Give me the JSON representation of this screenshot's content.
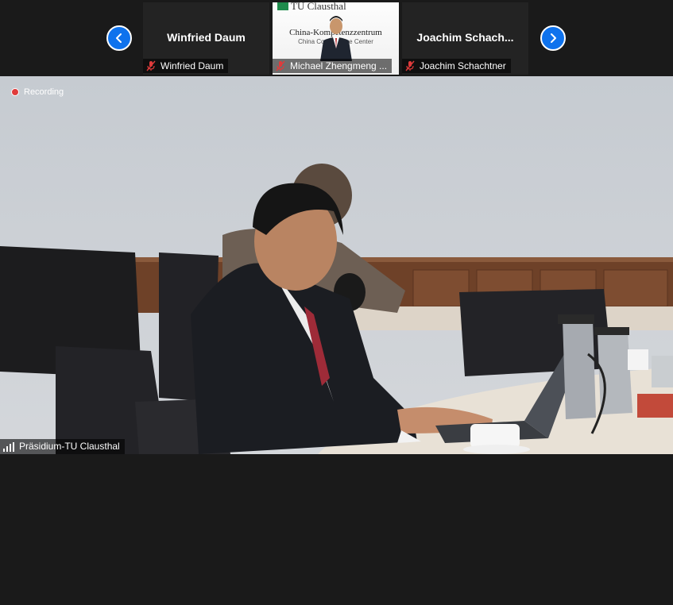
{
  "recording": {
    "label": "Recording"
  },
  "gallery": {
    "participants": [
      {
        "display_name": "Winfried Daum",
        "label": "Winfried Daum",
        "muted": true,
        "video": false
      },
      {
        "display_name": "",
        "label": "Michael Zhengmeng ...",
        "muted": true,
        "video": true,
        "background": {
          "org": "TU Clausthal",
          "line1": "China-Kompetenzzentrum",
          "line2": "China Competence Center"
        }
      },
      {
        "display_name": "Joachim  Schach...",
        "label": "Joachim Schachtner",
        "muted": true,
        "video": false
      }
    ]
  },
  "main": {
    "speaker_label": "Präsidium-TU Clausthal"
  },
  "colors": {
    "accent": "#0e72ed",
    "muted_icon": "#e03b3b",
    "background": "#1a1a1a"
  }
}
